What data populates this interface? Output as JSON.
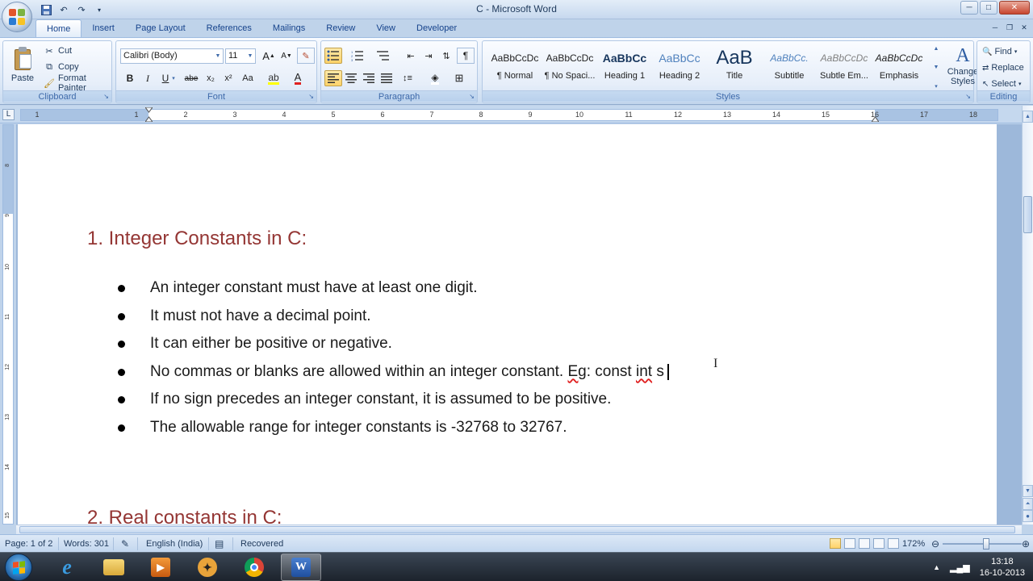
{
  "window": {
    "title": "C - Microsoft Word",
    "minimize": "─",
    "maximize": "□",
    "close": "✕"
  },
  "qat": {
    "save_icon": "save-icon",
    "undo_icon": "undo-icon",
    "redo_icon": "redo-icon"
  },
  "tabs": [
    "Home",
    "Insert",
    "Page Layout",
    "References",
    "Mailings",
    "Review",
    "View",
    "Developer"
  ],
  "ribbon": {
    "clipboard": {
      "label": "Clipboard",
      "paste": "Paste",
      "cut": "Cut",
      "copy": "Copy",
      "format_painter": "Format Painter"
    },
    "font": {
      "label": "Font",
      "font_name": "Calibri (Body)",
      "font_size": "11",
      "bold": "B",
      "italic": "I",
      "underline": "U",
      "strikethrough": "abe",
      "subscript": "x₂",
      "superscript": "x²",
      "change_case": "Aa",
      "grow": "A",
      "shrink": "A"
    },
    "paragraph": {
      "label": "Paragraph"
    },
    "styles": {
      "label": "Styles",
      "items": [
        {
          "preview": "AaBbCcDc",
          "name": "¶ Normal"
        },
        {
          "preview": "AaBbCcDc",
          "name": "¶ No Spaci..."
        },
        {
          "preview": "AaBbCc",
          "name": "Heading 1"
        },
        {
          "preview": "AaBbCc",
          "name": "Heading 2"
        },
        {
          "preview": "AaB",
          "name": "Title"
        },
        {
          "preview": "AaBbCc.",
          "name": "Subtitle"
        },
        {
          "preview": "AaBbCcDc",
          "name": "Subtle Em..."
        },
        {
          "preview": "AaBbCcDc",
          "name": "Emphasis"
        }
      ],
      "change_styles_line1": "Change",
      "change_styles_line2": "Styles"
    },
    "editing": {
      "label": "Editing",
      "find": "Find",
      "replace": "Replace",
      "select": "Select"
    }
  },
  "ruler": {
    "corner": "L",
    "ticks": [
      "1",
      "1",
      "2",
      "3",
      "4",
      "5",
      "6",
      "7",
      "8",
      "9",
      "10",
      "11",
      "12",
      "13",
      "14",
      "15",
      "16",
      "17",
      "18"
    ]
  },
  "document": {
    "heading1": "1. Integer Constants in C:",
    "bullets": [
      "An integer constant must have at least one digit.",
      "It must not have a decimal point.",
      "It can either be positive or negative.",
      "If no sign precedes an integer constant, it is assumed to be positive.",
      "The allowable range for integer constants is -32768 to 32767."
    ],
    "bullet4_prefix": "No commas or blanks are allowed within an integer constant. ",
    "bullet4_eg": "Eg",
    "bullet4_mid": ": const ",
    "bullet4_int": "int",
    "bullet4_end": " s",
    "heading2": "2. Real constants in C:"
  },
  "status": {
    "page": "Page: 1 of 2",
    "words": "Words: 301",
    "language": "English (India)",
    "recovered": "Recovered",
    "zoom": "172%"
  },
  "taskbar": {
    "time": "13:18",
    "date": "16-10-2013"
  },
  "colors": {
    "heading": "#943634",
    "ribbon_accent": "#3e6aaa"
  }
}
